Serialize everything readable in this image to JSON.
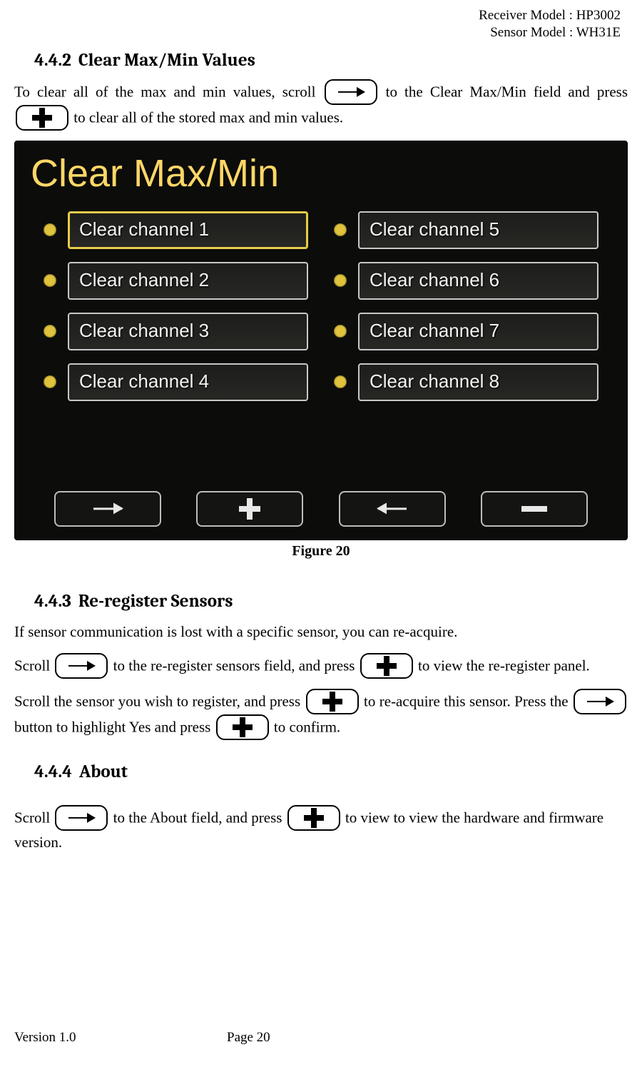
{
  "header": {
    "receiver": "Receiver Model : HP3002",
    "sensor": "Sensor Model : WH31E"
  },
  "s442": {
    "no": "4.4.2",
    "title": "Clear Max/Min Values",
    "p1a": "To  clear  all  of  the  max  and  min  values,  scroll ",
    "p1b": " to  the  Clear  Max/Min  field  and  press ",
    "p1c": " to clear all of the stored max and min values."
  },
  "figure": {
    "caption": "Figure 20",
    "screen_title": "Clear Max/Min",
    "left": [
      "Clear channel 1",
      "Clear channel 2",
      "Clear channel 3",
      "Clear channel 4"
    ],
    "right": [
      "Clear channel 5",
      "Clear channel 6",
      "Clear channel 7",
      "Clear channel 8"
    ]
  },
  "s443": {
    "no": "4.4.3",
    "title": "Re-register Sensors",
    "p1": "If sensor communication is lost with a specific sensor, you can re-acquire.",
    "p2a": "Scroll ",
    "p2b": " to the re-register sensors field, and press ",
    "p2c": " to view the re-register panel.",
    "p3a": "Scroll  the  sensor  you  wish  to  register,  and  press ",
    "p3b": " to  re-acquire  this  sensor.  Press  the ",
    "p3c": " button to highlight Yes and press ",
    "p3d": " to confirm."
  },
  "s444": {
    "no": "4.4.4",
    "title": "About",
    "p1a": "Scroll ",
    "p1b": " to the About field, and press ",
    "p1c": " to view to view the hardware and firmware version."
  },
  "footer": {
    "version": "Version 1.0",
    "page": "Page 20"
  }
}
